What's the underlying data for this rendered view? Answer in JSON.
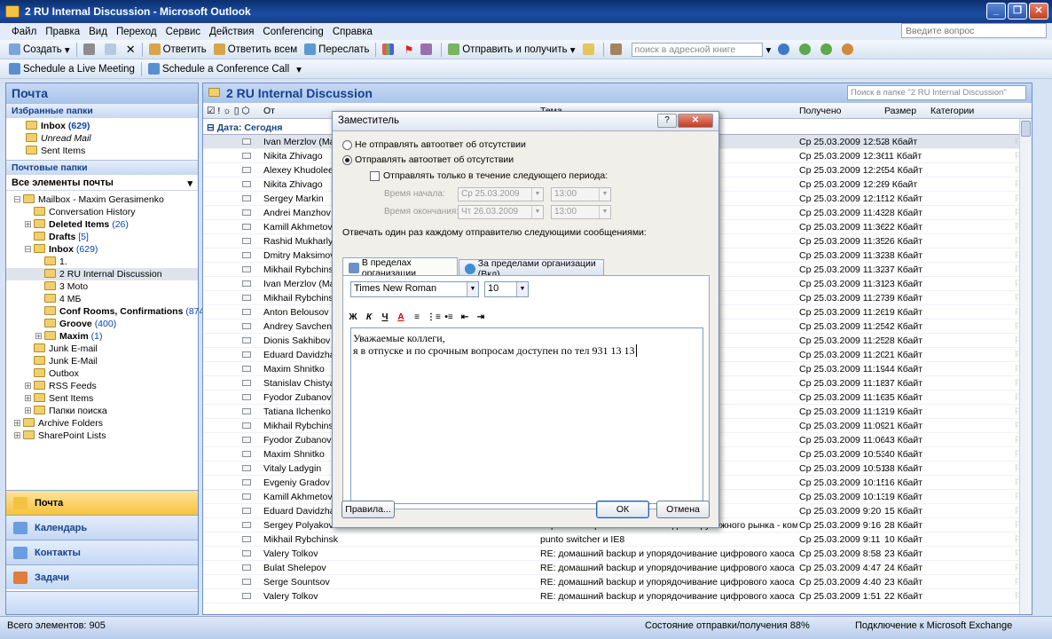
{
  "window": {
    "title": "2 RU Internal Discussion - Microsoft Outlook"
  },
  "menu": [
    "Файл",
    "Правка",
    "Вид",
    "Переход",
    "Сервис",
    "Действия",
    "Conferencing",
    "Справка"
  ],
  "ask_box": {
    "placeholder": "Введите вопрос"
  },
  "toolbar1": {
    "new": "Создать",
    "reply": "Ответить",
    "reply_all": "Ответить всем",
    "forward": "Переслать",
    "send_receive": "Отправить и получить",
    "address_search": "поиск в адресной книге"
  },
  "toolbar2": {
    "live_meeting": "Schedule a Live Meeting",
    "conference_call": "Schedule a Conference Call"
  },
  "nav": {
    "title": "Почта",
    "favorites_header": "Избранные папки",
    "favorites": [
      {
        "label": "Inbox",
        "count": "(629)",
        "bold": true
      },
      {
        "label": "Unread Mail",
        "count": "",
        "italic": true
      },
      {
        "label": "Sent Items",
        "count": ""
      }
    ],
    "mail_folders_header": "Почтовые папки",
    "all_items": "Все элементы почты",
    "tree": [
      {
        "label": "Mailbox - Maxim Gerasimenko",
        "count": "",
        "indent": 0,
        "toggle": "⊟"
      },
      {
        "label": "Conversation History",
        "count": "",
        "indent": 1,
        "toggle": ""
      },
      {
        "label": "Deleted Items",
        "count": "(26)",
        "indent": 1,
        "toggle": "⊞",
        "bold": true
      },
      {
        "label": "Drafts",
        "count": "[5]",
        "indent": 1,
        "toggle": "",
        "bold": true
      },
      {
        "label": "Inbox",
        "count": "(629)",
        "indent": 1,
        "toggle": "⊟",
        "bold": true
      },
      {
        "label": "1.",
        "count": "",
        "indent": 2,
        "toggle": ""
      },
      {
        "label": "2 RU Internal Discussion",
        "count": "",
        "indent": 2,
        "toggle": "",
        "selected": true
      },
      {
        "label": "3 Moto",
        "count": "",
        "indent": 2,
        "toggle": ""
      },
      {
        "label": "4 МБ",
        "count": "",
        "indent": 2,
        "toggle": ""
      },
      {
        "label": "Conf Rooms, Confirmations",
        "count": "(874)",
        "indent": 2,
        "toggle": "",
        "bold": true
      },
      {
        "label": "Groove",
        "count": "(400)",
        "indent": 2,
        "toggle": "",
        "bold": true
      },
      {
        "label": "Maxim",
        "count": "(1)",
        "indent": 2,
        "toggle": "⊞",
        "bold": true
      },
      {
        "label": "Junk E-mail",
        "count": "",
        "indent": 1,
        "toggle": ""
      },
      {
        "label": "Junk E-Mail",
        "count": "",
        "indent": 1,
        "toggle": ""
      },
      {
        "label": "Outbox",
        "count": "",
        "indent": 1,
        "toggle": ""
      },
      {
        "label": "RSS Feeds",
        "count": "",
        "indent": 1,
        "toggle": "⊞"
      },
      {
        "label": "Sent Items",
        "count": "",
        "indent": 1,
        "toggle": "⊞"
      },
      {
        "label": "Папки поиска",
        "count": "",
        "indent": 1,
        "toggle": "⊞"
      },
      {
        "label": "Archive Folders",
        "count": "",
        "indent": 0,
        "toggle": "⊞"
      },
      {
        "label": "SharePoint Lists",
        "count": "",
        "indent": 0,
        "toggle": "⊞"
      }
    ],
    "buttons": [
      {
        "label": "Почта",
        "active": true
      },
      {
        "label": "Календарь"
      },
      {
        "label": "Контакты"
      },
      {
        "label": "Задачи"
      }
    ]
  },
  "list": {
    "title": "2 RU Internal Discussion",
    "search_placeholder": "Поиск в папке \"2 RU Internal Discussion\"",
    "columns": {
      "from": "От",
      "subject": "Тема",
      "received": "Получено",
      "size": "Размер",
      "categories": "Категории"
    },
    "group": "Дата: Сегодня",
    "rows": [
      {
        "from": "Ivan Merzlov (Manj",
        "subject": "",
        "received": "Ср 25.03.2009 12:52",
        "size": "8 Кбайт",
        "sel": true
      },
      {
        "from": "Nikita Zhivago",
        "subject": "м ответившим - A...",
        "received": "Ср 25.03.2009 12:36",
        "size": "11 Кбайт"
      },
      {
        "from": "Alexey Khudoleev",
        "subject": "",
        "received": "Ср 25.03.2009 12:29",
        "size": "54 Кбайт"
      },
      {
        "from": "Nikita Zhivago",
        "subject": "",
        "received": "Ср 25.03.2009 12:28",
        "size": "9 Кбайт"
      },
      {
        "from": "Sergey Markin",
        "subject": "",
        "received": "Ср 25.03.2009 12:15",
        "size": "12 Кбайт"
      },
      {
        "from": "Andrei Manzhov",
        "subject": "рынка - кому ...",
        "received": "Ср 25.03.2009 11:43",
        "size": "28 Кбайт"
      },
      {
        "from": "Kamill Akhmetov (N",
        "subject": "",
        "received": "Ср 25.03.2009 11:36",
        "size": "22 Кбайт"
      },
      {
        "from": "Rashid Mukharlyam",
        "subject": "",
        "received": "Ср 25.03.2009 11:35",
        "size": "26 Кбайт"
      },
      {
        "from": "Dmitry Maksimov",
        "subject": "",
        "received": "Ср 25.03.2009 11:32",
        "size": "38 Кбайт"
      },
      {
        "from": "Mikhail Rybchinskiy",
        "subject": "",
        "received": "Ср 25.03.2009 11:32",
        "size": "37 Кбайт"
      },
      {
        "from": "Ivan Merzlov (Man",
        "subject": "",
        "received": "Ср 25.03.2009 11:31",
        "size": "23 Кбайт"
      },
      {
        "from": "Mikhail Rybchinskiy",
        "subject": "",
        "received": "Ср 25.03.2009 11:27",
        "size": "39 Кбайт"
      },
      {
        "from": "Anton Belousov",
        "subject": "",
        "received": "Ср 25.03.2009 11:26",
        "size": "19 Кбайт"
      },
      {
        "from": "Andrey Savchenko",
        "subject": "",
        "received": "Ср 25.03.2009 11:25",
        "size": "42 Кбайт"
      },
      {
        "from": "Dionis Sakhibov",
        "subject": "",
        "received": "Ср 25.03.2009 11:25",
        "size": "28 Кбайт"
      },
      {
        "from": "Eduard Davidzhan",
        "subject": "",
        "received": "Ср 25.03.2009 11:20",
        "size": "21 Кбайт"
      },
      {
        "from": "Maxim Shnitko",
        "subject": "",
        "received": "Ср 25.03.2009 11:19",
        "size": "44 Кбайт"
      },
      {
        "from": "Stanislav Chistyako",
        "subject": "",
        "received": "Ср 25.03.2009 11:18",
        "size": "37 Кбайт"
      },
      {
        "from": "Fyodor Zubanov",
        "subject": "",
        "received": "Ср 25.03.2009 11:16",
        "size": "35 Кбайт"
      },
      {
        "from": "Tatiana Ilchenko",
        "subject": "",
        "received": "Ср 25.03.2009 11:13",
        "size": "19 Кбайт"
      },
      {
        "from": "Mikhail Rybchinskiy",
        "subject": "",
        "received": "Ср 25.03.2009 11:09",
        "size": "21 Кбайт"
      },
      {
        "from": "Fyodor Zubanov",
        "subject": "",
        "received": "Ср 25.03.2009 11:06",
        "size": "43 Кбайт"
      },
      {
        "from": "Maxim Shnitko",
        "subject": "",
        "received": "Ср 25.03.2009 10:53",
        "size": "40 Кбайт"
      },
      {
        "from": "Vitaly Ladygin",
        "subject": "",
        "received": "Ср 25.03.2009 10:51",
        "size": "38 Кбайт"
      },
      {
        "from": "Evgeniy Gradov (Se",
        "subject": "",
        "received": "Ср 25.03.2009 10:15",
        "size": "16 Кбайт"
      },
      {
        "from": "Kamill Akhmetov (N",
        "subject": "",
        "received": "Ср 25.03.2009 10:13",
        "size": "19 Кбайт"
      },
      {
        "from": "Eduard Davidzhan",
        "subject": "",
        "received": "Ср 25.03.2009 9:20",
        "size": "15 Кбайт"
      },
      {
        "from": "Sergey Polyakov",
        "subject": "Коробочное решение на WSS для зарубежного рынка - кому про...",
        "received": "Ср 25.03.2009 9:16",
        "size": "28 Кбайт"
      },
      {
        "from": "Mikhail Rybchinskiy",
        "subject": "punto switcher и IE8",
        "received": "Ср 25.03.2009 9:11",
        "size": "10 Кбайт"
      },
      {
        "from": "Valery Tolkov",
        "subject": "RE: домашний backup и упорядочивание цифрового хаоса",
        "received": "Ср 25.03.2009 8:58",
        "size": "23 Кбайт"
      },
      {
        "from": "Bulat Shelepov",
        "subject": "RE: домашний backup и упорядочивание цифрового хаоса",
        "received": "Ср 25.03.2009 4:47",
        "size": "24 Кбайт"
      },
      {
        "from": "Serge Sountsov",
        "subject": "RE: домашний backup и упорядочивание цифрового хаоса",
        "received": "Ср 25.03.2009 4:40",
        "size": "23 Кбайт"
      },
      {
        "from": "Valery Tolkov",
        "subject": "RE: домашний backup и упорядочивание цифрового хаоса",
        "received": "Ср 25.03.2009 1:51",
        "size": "22 Кбайт"
      }
    ]
  },
  "status": {
    "total": "Всего элементов: 905",
    "sync": "Состояние отправки/получения 88%",
    "connection": "Подключение к Microsoft Exchange"
  },
  "dialog": {
    "title": "Заместитель",
    "radio_off": "Не отправлять автоответ об отсутствии",
    "radio_on": "Отправлять автоответ об отсутствии",
    "period_check": "Отправлять только в течение следующего периода:",
    "start_label": "Время начала:",
    "start_date": "Ср 25.03.2009",
    "start_time": "13:00",
    "end_label": "Время окончания:",
    "end_date": "Чт 26.03.2009",
    "end_time": "13:00",
    "reply_once": "Отвечать один раз каждому отправителю следующими сообщениями:",
    "tab_inside": "В пределах организации",
    "tab_outside": "За пределами организации (Вкл)",
    "font": "Times New Roman",
    "size": "10",
    "body_line1": "Уважаемые коллеги,",
    "body_line2": "я в отпуске и по срочным вопросам доступен по тел 931 13 13",
    "rules": "Правила...",
    "ok": "ОК",
    "cancel": "Отмена"
  }
}
